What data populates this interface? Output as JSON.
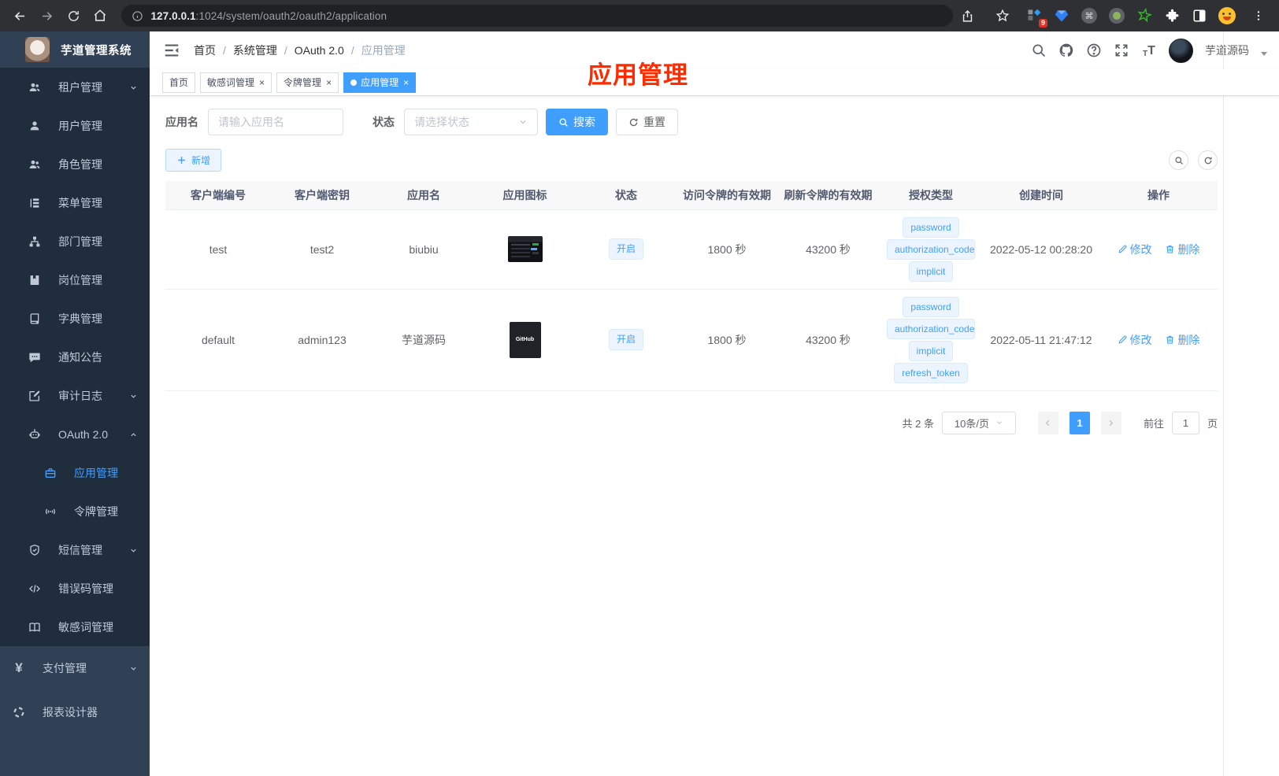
{
  "browser": {
    "url_host": "127.0.0.1",
    "url_path": ":1024/system/oauth2/oauth2/application",
    "ext_badge": "9"
  },
  "sidebar": {
    "logo_title": "芋道管理系统",
    "items": [
      {
        "label": "租户管理"
      },
      {
        "label": "用户管理"
      },
      {
        "label": "角色管理"
      },
      {
        "label": "菜单管理"
      },
      {
        "label": "部门管理"
      },
      {
        "label": "岗位管理"
      },
      {
        "label": "字典管理"
      },
      {
        "label": "通知公告"
      },
      {
        "label": "审计日志"
      },
      {
        "label": "OAuth 2.0"
      },
      {
        "label": "应用管理"
      },
      {
        "label": "令牌管理"
      },
      {
        "label": "短信管理"
      },
      {
        "label": "错误码管理"
      },
      {
        "label": "敏感词管理"
      },
      {
        "label": "支付管理"
      },
      {
        "label": "报表设计器"
      }
    ]
  },
  "header": {
    "breadcrumbs": [
      "首页",
      "系统管理",
      "OAuth 2.0",
      "应用管理"
    ],
    "username": "芋道源码"
  },
  "tabs": [
    {
      "label": "首页"
    },
    {
      "label": "敏感词管理"
    },
    {
      "label": "令牌管理"
    },
    {
      "label": "应用管理"
    }
  ],
  "overlay_title": "应用管理",
  "filters": {
    "name_label": "应用名",
    "name_placeholder": "请输入应用名",
    "status_label": "状态",
    "status_placeholder": "请选择状态",
    "search_label": "搜索",
    "reset_label": "重置"
  },
  "toolbar": {
    "add_label": "新增"
  },
  "table": {
    "columns": [
      "客户端编号",
      "客户端密钥",
      "应用名",
      "应用图标",
      "状态",
      "访问令牌的有效期",
      "刷新令牌的有效期",
      "授权类型",
      "创建时间",
      "操作"
    ],
    "actions": {
      "edit": "修改",
      "delete": "删除"
    },
    "rows": [
      {
        "client_id": "test",
        "secret": "test2",
        "name": "biubiu",
        "status": "开启",
        "access_validity": "1800 秒",
        "refresh_validity": "43200 秒",
        "grant_types": [
          "password",
          "authorization_code",
          "implicit"
        ],
        "create_time": "2022-05-12 00:28:20"
      },
      {
        "client_id": "default",
        "secret": "admin123",
        "name": "芋道源码",
        "status": "开启",
        "access_validity": "1800 秒",
        "refresh_validity": "43200 秒",
        "grant_types": [
          "password",
          "authorization_code",
          "implicit",
          "refresh_token"
        ],
        "create_time": "2022-05-11 21:47:12"
      }
    ]
  },
  "pagination": {
    "total_label": "共 2 条",
    "page_size": "10条/页",
    "current_page": "1",
    "goto_label": "前往",
    "goto_value": "1",
    "page_unit": "页"
  }
}
